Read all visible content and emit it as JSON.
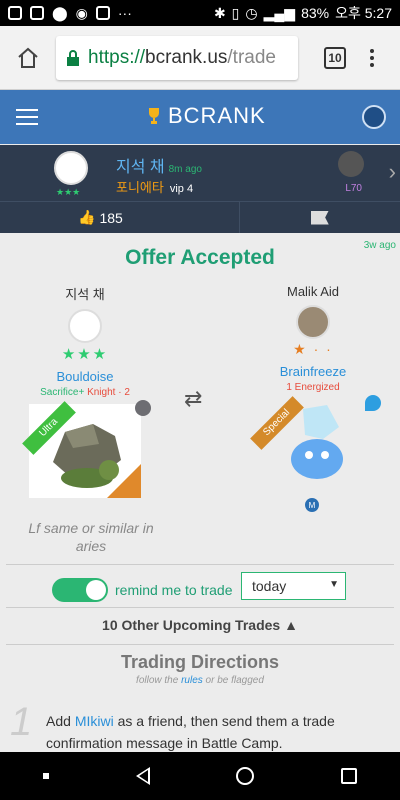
{
  "status_bar": {
    "battery": "83%",
    "time": "오후 5:27",
    "dots": "···"
  },
  "browser": {
    "url_https": "https://",
    "url_domain": "bcrank.us",
    "url_path": "/trade",
    "tab_count": "10"
  },
  "app": {
    "brand": "BCRANK"
  },
  "post": {
    "username": "지석 채",
    "time": "8m ago",
    "guild": "포니에타",
    "vip": "vip 4",
    "opponent_level": "L70",
    "likes": "185",
    "stars": "★★★"
  },
  "offer": {
    "ago": "3w ago",
    "title": "Offer Accepted",
    "left": {
      "name": "지석 채",
      "stars": "★★★",
      "monster": "Bouldoise",
      "sub_green": "Sacrifice+",
      "sub_red": "Knight · 2",
      "rarity": "Ultra"
    },
    "right": {
      "name": "Malik Aid",
      "stars": "★ · ·",
      "monster": "Brainfreeze",
      "sub_red": "1 Energized",
      "rarity": "Special",
      "badge": "M"
    },
    "swap_icon": "⇄",
    "note": "Lf same or similar in aries",
    "remind_label": "remind me to trade",
    "remind_select": "today",
    "upcoming": "10 Other Upcoming Trades",
    "upcoming_icon": "▲"
  },
  "directions": {
    "title": "Trading Directions",
    "sub_pre": "follow the ",
    "sub_link": "rules",
    "sub_post": " or be flagged",
    "step_num": "1",
    "step_pre": "Add ",
    "step_link": "MIkiwi",
    "step_post": " as a friend, then send them a trade confirmation message in Battle Camp."
  }
}
